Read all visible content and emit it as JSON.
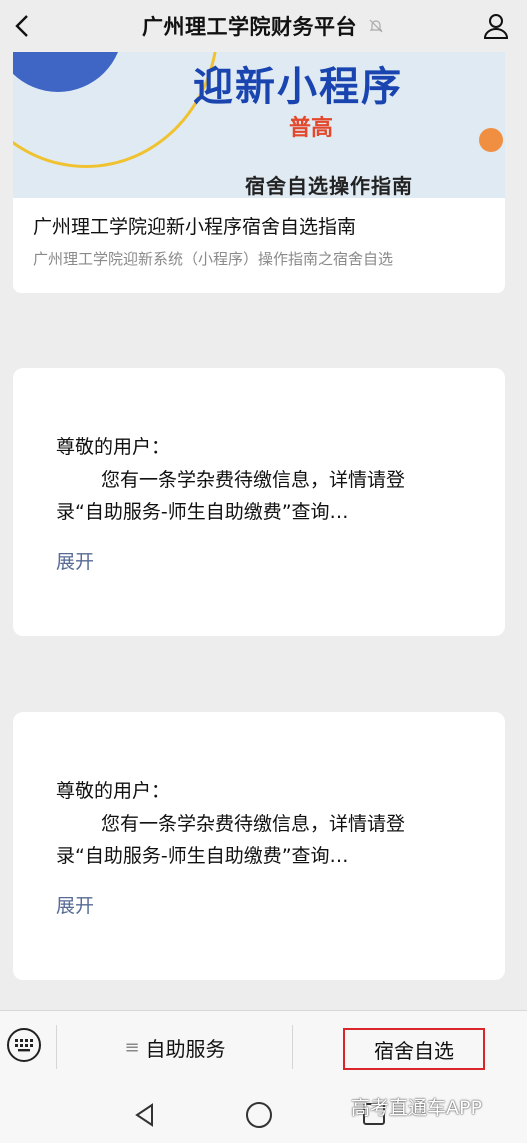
{
  "header": {
    "title": "广州理工学院财务平台"
  },
  "article": {
    "banner_line1": "迎新小程序",
    "banner_line2": "普高",
    "banner_line3": "宿舍自选操作指南",
    "title": "广州理工学院迎新小程序宿舍自选指南",
    "subtitle": "广州理工学院迎新系统（小程序）操作指南之宿舍自选"
  },
  "messages": [
    {
      "greeting": "尊敬的用户：",
      "line1": "您有一条学杂费待缴信息，详情请登",
      "line2": "录“自助服务-师生自助缴费”查询…",
      "expand": "展开"
    },
    {
      "greeting": "尊敬的用户：",
      "line1": "您有一条学杂费待缴信息，详情请登",
      "line2": "录“自助服务-师生自助缴费”查询…",
      "expand": "展开"
    }
  ],
  "menu": {
    "item1": "自助服务",
    "item2": "宿舍自选"
  },
  "watermark": "高考直通车APP",
  "colors": {
    "link": "#576b95",
    "highlight_border": "#d8262b"
  }
}
